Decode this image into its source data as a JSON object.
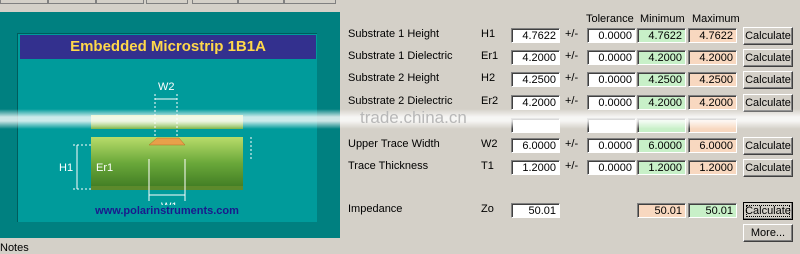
{
  "diagram": {
    "title": "Embedded Microstrip 1B1A",
    "labels": {
      "w2": "W2",
      "w1": "W1",
      "h1": "H1",
      "er1": "Er1"
    },
    "url": "www.polarinstruments.com"
  },
  "headers": {
    "tolerance": "Tolerance",
    "minimum": "Minimum",
    "maximum": "Maximum"
  },
  "rows": [
    {
      "label": "Substrate 1 Height",
      "symbol": "H1",
      "value": "4.7622",
      "pm": "+/-",
      "tolerance": "0.0000",
      "minimum": "4.7622",
      "maximum": "4.7622",
      "button": "Calculate"
    },
    {
      "label": "Substrate 1 Dielectric",
      "symbol": "Er1",
      "value": "4.2000",
      "pm": "+/-",
      "tolerance": "0.0000",
      "minimum": "4.2000",
      "maximum": "4.2000",
      "button": "Calculate"
    },
    {
      "label": "Substrate 2 Height",
      "symbol": "H2",
      "value": "4.2500",
      "pm": "+/-",
      "tolerance": "0.0000",
      "minimum": "4.2500",
      "maximum": "4.2500",
      "button": "Calculate"
    },
    {
      "label": "Substrate 2 Dielectric",
      "symbol": "Er2",
      "value": "4.2000",
      "pm": "+/-",
      "tolerance": "0.0000",
      "minimum": "4.2000",
      "maximum": "4.2000",
      "button": "Calculate"
    },
    {
      "label": "Upper Trace Width",
      "symbol": "W2",
      "value": "6.0000",
      "pm": "+/-",
      "tolerance": "0.0000",
      "minimum": "6.0000",
      "maximum": "6.0000",
      "button": "Calculate"
    },
    {
      "label": "Trace Thickness",
      "symbol": "T1",
      "value": "1.2000",
      "pm": "+/-",
      "tolerance": "0.0000",
      "minimum": "1.2000",
      "maximum": "1.2000",
      "button": "Calculate"
    }
  ],
  "impedance": {
    "label": "Impedance",
    "symbol": "Zo",
    "value": "50.01",
    "minimum": "50.01",
    "maximum": "50.01",
    "button": "Calculate",
    "more_button": "More..."
  },
  "watermark": "trade.china.cn",
  "notes_label": "Notes"
}
